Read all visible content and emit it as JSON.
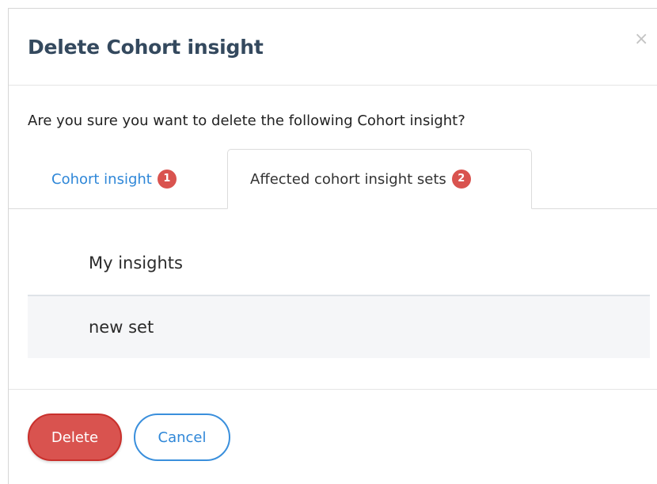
{
  "modal": {
    "title": "Delete Cohort insight",
    "close_icon": "×",
    "question": "Are you sure you want to delete the following Cohort insight?"
  },
  "tabs": [
    {
      "label": "Cohort insight",
      "count": "1",
      "active": false
    },
    {
      "label": "Affected cohort insight sets",
      "count": "2",
      "active": true
    }
  ],
  "affected_sets": [
    {
      "name": "My insights"
    },
    {
      "name": "new set"
    }
  ],
  "footer": {
    "delete_label": "Delete",
    "cancel_label": "Cancel"
  },
  "colors": {
    "title": "#34495e",
    "link": "#2f87d8",
    "badge": "#d9534f",
    "delete_button": "#d9534f",
    "cancel_border": "#3a8fdc"
  }
}
